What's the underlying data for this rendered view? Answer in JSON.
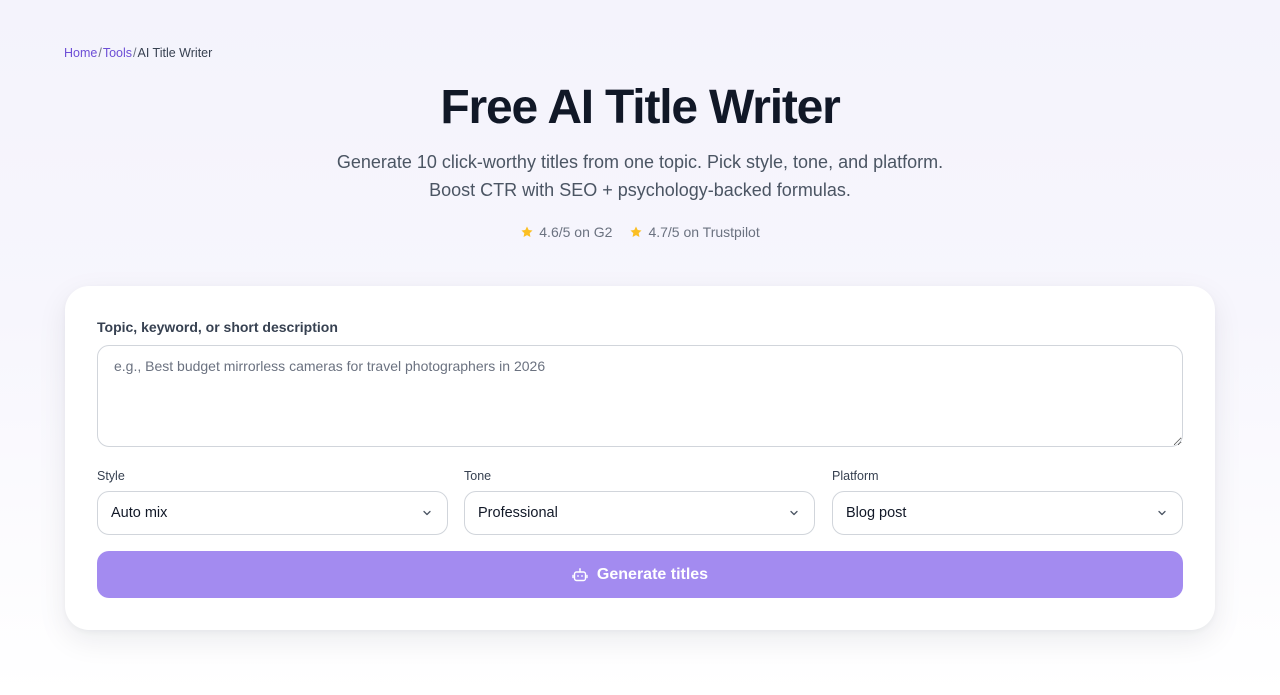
{
  "breadcrumb": {
    "items": [
      "Home",
      "Tools",
      "AI Title Writer"
    ],
    "separator": "/"
  },
  "hero": {
    "title": "Free AI Title Writer",
    "subtitle_line1": "Generate 10 click-worthy titles from one topic. Pick style, tone, and platform.",
    "subtitle_line2": "Boost CTR with SEO + psychology-backed formulas."
  },
  "ratings": [
    {
      "icon": "star-icon",
      "text": "4.6/5 on G2"
    },
    {
      "icon": "star-icon",
      "text": "4.7/5 on Trustpilot"
    }
  ],
  "form": {
    "topic_label": "Topic, keyword, or short description",
    "topic_value": "",
    "topic_placeholder": "e.g., Best budget mirrorless cameras for travel photographers in 2026",
    "selects": [
      {
        "label": "Style",
        "value": "Auto mix"
      },
      {
        "label": "Tone",
        "value": "Professional"
      },
      {
        "label": "Platform",
        "value": "Blog post"
      }
    ],
    "generate_label": "Generate titles"
  },
  "colors": {
    "accent": "#a38bf0",
    "link": "#6d4fd6",
    "star": "#fbbf24",
    "heading": "#111827"
  }
}
